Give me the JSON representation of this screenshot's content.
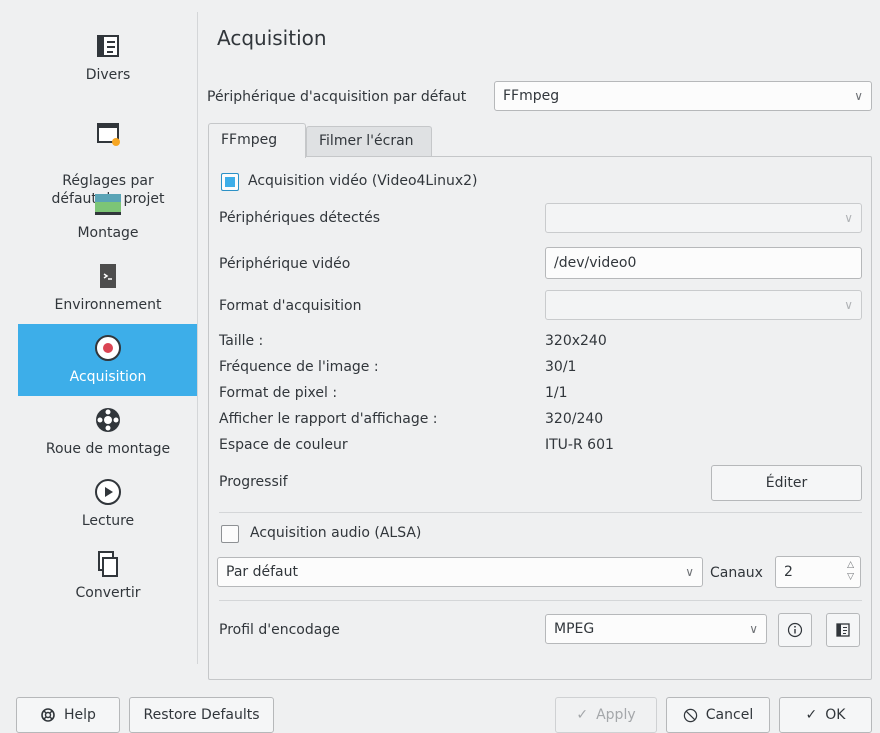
{
  "sidebar": {
    "items": [
      {
        "label": "Divers",
        "icon": "misc-icon"
      },
      {
        "label": "Réglages par\ndéfaut du projet",
        "icon": "film-icon"
      },
      {
        "label": "Montage",
        "icon": "timeline-icon"
      },
      {
        "label": "Environnement",
        "icon": "terminal-icon"
      },
      {
        "label": "Acquisition",
        "icon": "record-icon"
      },
      {
        "label": "Roue de montage",
        "icon": "jog-wheel-icon"
      },
      {
        "label": "Lecture",
        "icon": "play-icon"
      },
      {
        "label": "Convertir",
        "icon": "convert-icon"
      }
    ]
  },
  "page": {
    "title": "Acquisition",
    "default_device_label": "Périphérique d'acquisition par défaut",
    "default_device_value": "FFmpeg"
  },
  "tabs": [
    {
      "label": "FFmpeg"
    },
    {
      "label": "Filmer l'écran"
    }
  ],
  "video": {
    "checkbox_label": "Acquisition vidéo (Video4Linux2)",
    "detected_label": "Périphériques détectés",
    "detected_value": "",
    "device_label": "Périphérique vidéo",
    "device_value": "/dev/video0",
    "format_label": "Format d'acquisition",
    "format_value": "",
    "size_label": "Taille :",
    "size_value": "320x240",
    "fps_label": "Fréquence de l'image :",
    "fps_value": "30/1",
    "pixel_label": "Format de pixel :",
    "pixel_value": "1/1",
    "display_label": "Afficher le rapport d'affichage :",
    "display_value": "320/240",
    "color_label": "Espace de couleur",
    "color_value": "ITU-R 601",
    "progressive_label": "Progressif",
    "edit_button": "Éditer"
  },
  "audio": {
    "checkbox_label": "Acquisition audio (ALSA)",
    "device_value": "Par défaut",
    "channels_label": "Canaux",
    "channels_value": "2"
  },
  "encoding": {
    "label": "Profil d'encodage",
    "value": "MPEG"
  },
  "footer": {
    "help": "Help",
    "restore": "Restore Defaults",
    "apply": "Apply",
    "cancel": "Cancel",
    "ok": "OK"
  },
  "colors": {
    "accent": "#3daee9",
    "background": "#eff0f1"
  }
}
